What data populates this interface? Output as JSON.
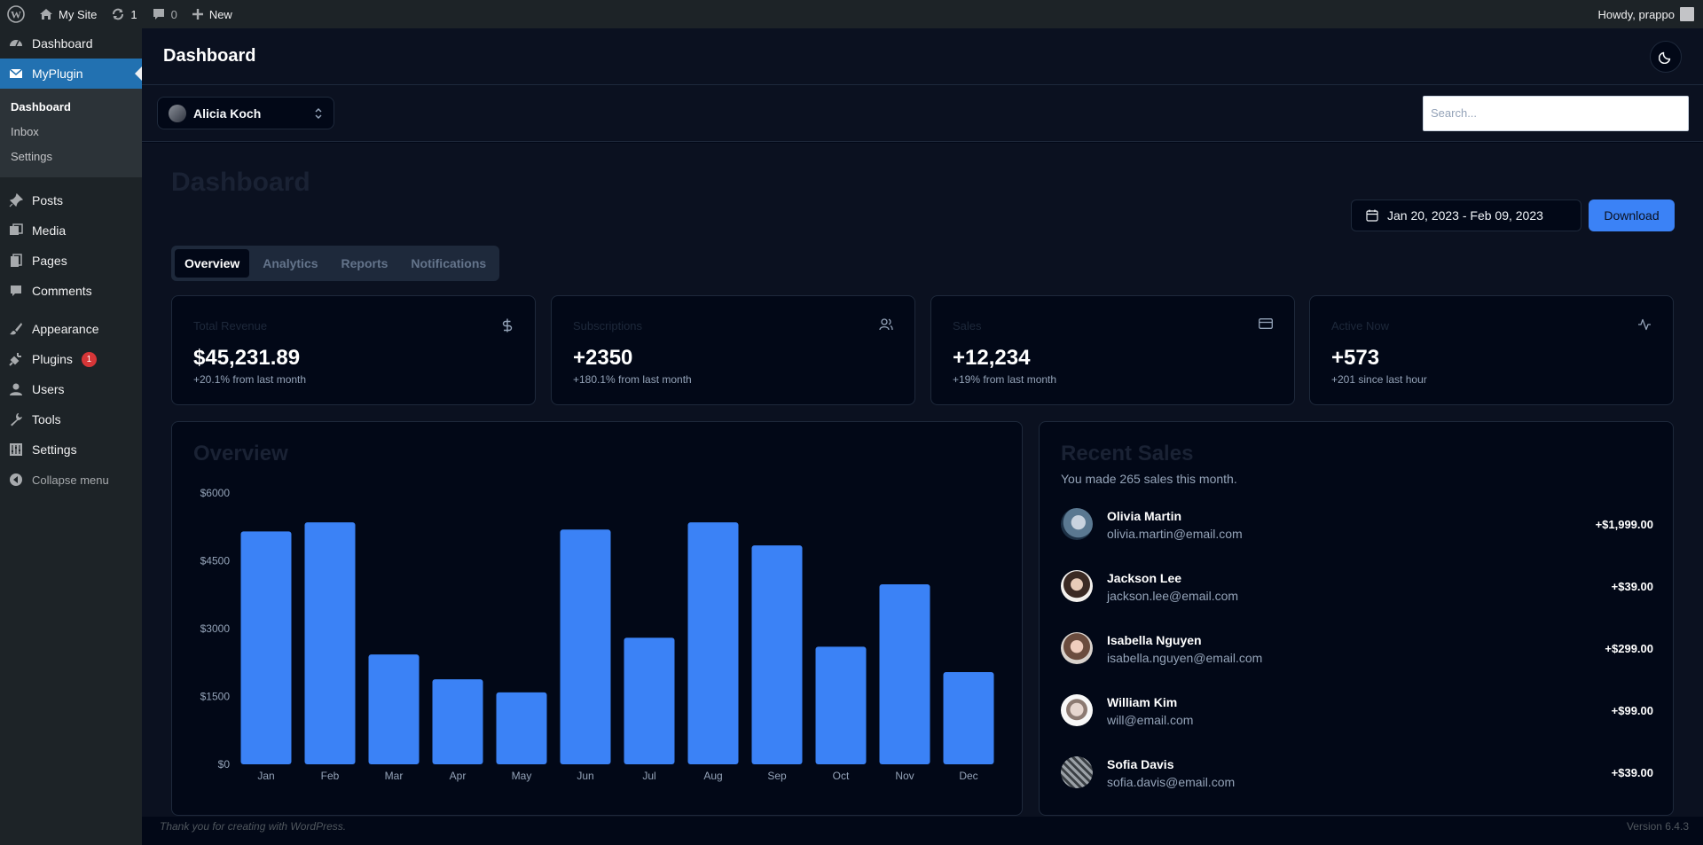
{
  "adminbar": {
    "site_name": "My Site",
    "updates_count": "1",
    "comments_count": "0",
    "new_label": "New",
    "howdy": "Howdy, prappo"
  },
  "wp_menu": {
    "dashboard": "Dashboard",
    "myplugin": "MyPlugin",
    "submenu": [
      "Dashboard",
      "Inbox",
      "Settings"
    ],
    "posts": "Posts",
    "media": "Media",
    "pages": "Pages",
    "comments": "Comments",
    "appearance": "Appearance",
    "plugins": "Plugins",
    "plugins_badge": "1",
    "users": "Users",
    "tools": "Tools",
    "settings": "Settings",
    "collapse": "Collapse menu"
  },
  "header": {
    "title": "Dashboard"
  },
  "account": {
    "name": "Alicia Koch"
  },
  "search": {
    "placeholder": "Search..."
  },
  "page": {
    "title": "Dashboard",
    "date_range": "Jan 20, 2023 - Feb 09, 2023",
    "download_label": "Download",
    "tabs": [
      "Overview",
      "Analytics",
      "Reports",
      "Notifications"
    ]
  },
  "stats": [
    {
      "label": "Total Revenue",
      "value": "$45,231.89",
      "sub": "+20.1% from last month",
      "icon": "dollar-icon"
    },
    {
      "label": "Subscriptions",
      "value": "+2350",
      "sub": "+180.1% from last month",
      "icon": "users-icon"
    },
    {
      "label": "Sales",
      "value": "+12,234",
      "sub": "+19% from last month",
      "icon": "credit-card-icon"
    },
    {
      "label": "Active Now",
      "value": "+573",
      "sub": "+201 since last hour",
      "icon": "activity-icon"
    }
  ],
  "overview": {
    "title": "Overview"
  },
  "chart_data": {
    "type": "bar",
    "categories": [
      "Jan",
      "Feb",
      "Mar",
      "Apr",
      "May",
      "Jun",
      "Jul",
      "Aug",
      "Sep",
      "Oct",
      "Nov",
      "Dec"
    ],
    "values": [
      5150,
      5350,
      2430,
      1880,
      1590,
      5190,
      2800,
      5350,
      4840,
      2600,
      3980,
      2040
    ],
    "ytick_labels": [
      "$0",
      "$1500",
      "$3000",
      "$4500",
      "$6000"
    ],
    "yticks": [
      0,
      1500,
      3000,
      4500,
      6000
    ],
    "ylim": [
      0,
      6000
    ],
    "grid": false,
    "bar_color": "#3b82f6"
  },
  "recent_sales": {
    "title": "Recent Sales",
    "description": "You made 265 sales this month.",
    "items": [
      {
        "name": "Olivia Martin",
        "email": "olivia.martin@email.com",
        "amount": "+$1,999.00"
      },
      {
        "name": "Jackson Lee",
        "email": "jackson.lee@email.com",
        "amount": "+$39.00"
      },
      {
        "name": "Isabella Nguyen",
        "email": "isabella.nguyen@email.com",
        "amount": "+$299.00"
      },
      {
        "name": "William Kim",
        "email": "will@email.com",
        "amount": "+$99.00"
      },
      {
        "name": "Sofia Davis",
        "email": "sofia.davis@email.com",
        "amount": "+$39.00"
      }
    ]
  },
  "footer": {
    "thanks": "Thank you for creating with WordPress.",
    "version": "Version 6.4.3"
  },
  "colors": {
    "accent": "#3b82f6",
    "wp_active": "#2271b1",
    "background": "#020817"
  }
}
